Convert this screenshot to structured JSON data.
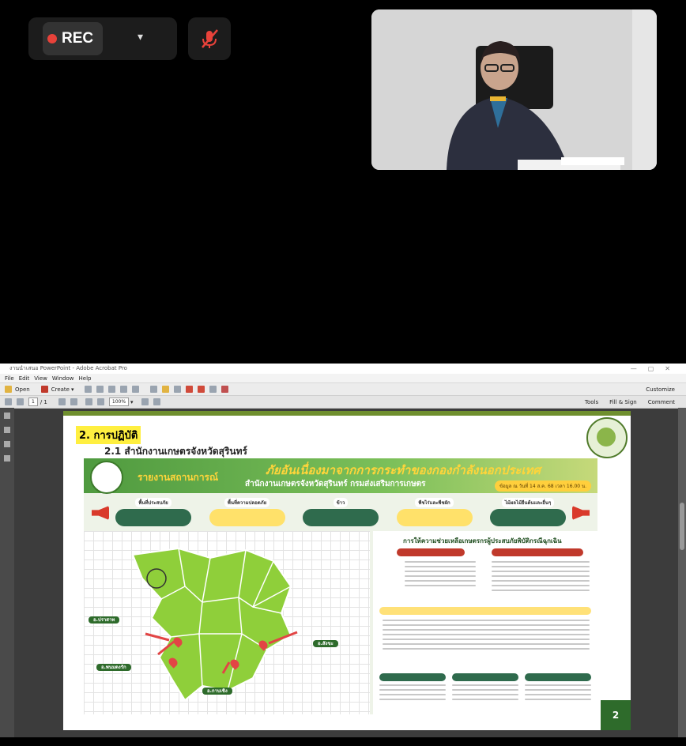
{
  "meeting": {
    "rec_label": "REC",
    "colors": {
      "rec_dot": "#e8423a",
      "mic_muted": "#e8423a"
    }
  },
  "acrobat": {
    "window_title": "งานนำเสนอ PowerPoint - Adobe Acrobat Pro",
    "menu": [
      "File",
      "Edit",
      "View",
      "Window",
      "Help"
    ],
    "toolbar": {
      "open_label": "Open",
      "create_label": "Create",
      "customize_label": "Customize"
    },
    "nav": {
      "page_current": "1",
      "page_total": "/ 1",
      "zoom": "100%"
    },
    "right_links": [
      "Tools",
      "Fill & Sign",
      "Comment"
    ]
  },
  "slide": {
    "heading1": "2. การปฏิบัติ",
    "heading2": "2.1 สำนักงานเกษตรจังหวัดสุรินทร์",
    "page_number": "2",
    "banner": {
      "left": "รายงานสถานการณ์",
      "right": "ภัยอันเนื่องมาจากการกระทำของกองกำลังนอกประเทศ",
      "sub": "สำนักงานเกษตรจังหวัดสุรินทร์   กรมส่งเสริมการเกษตร",
      "date": "ข้อมูล ณ วันที่ 14 ส.ค. 68 เวลา 16.00 น."
    },
    "stats": [
      {
        "title": "พื้นที่ประสบภัย",
        "style": "green"
      },
      {
        "title": "พื้นที่ความปลอดภัย",
        "style": "yellow"
      },
      {
        "title": "ข้าว",
        "style": "green"
      },
      {
        "title": "พืชไร่และพืชผัก",
        "style": "yellow"
      },
      {
        "title": "ไม้ผลไม้ยืนต้นและอื่นๆ",
        "style": "green"
      }
    ],
    "callouts": {
      "prasat": "อ.ปราสาท",
      "phanom_dong_rak": "อ.พนมดงรัก",
      "kap_choeng": "อ.กาบเชิง",
      "sangkha": "อ.สังขะ"
    },
    "right_panel": {
      "title": "การให้ความช่วยเหลือเกษตรกรผู้ประสบภัยพิบัติกรณีฉุกเฉิน"
    }
  }
}
